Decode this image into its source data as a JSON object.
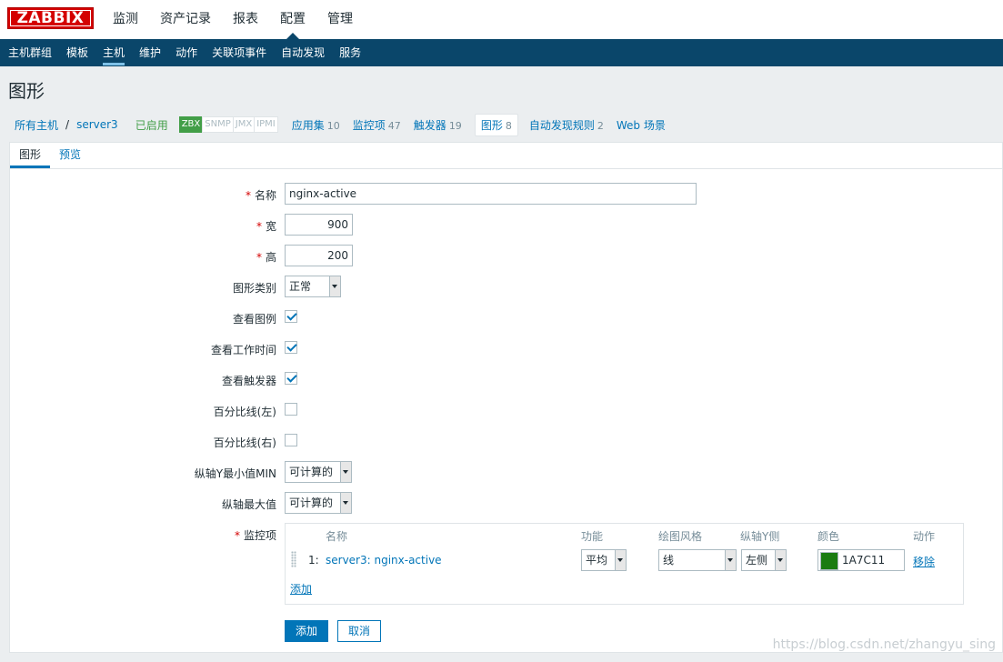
{
  "logo": "ZABBIX",
  "main_menu": [
    {
      "label": "监测"
    },
    {
      "label": "资产记录"
    },
    {
      "label": "报表"
    },
    {
      "label": "配置"
    },
    {
      "label": "管理"
    }
  ],
  "sub_menu": [
    {
      "label": "主机群组"
    },
    {
      "label": "模板"
    },
    {
      "label": "主机"
    },
    {
      "label": "维护"
    },
    {
      "label": "动作"
    },
    {
      "label": "关联项事件"
    },
    {
      "label": "自动发现"
    },
    {
      "label": "服务"
    }
  ],
  "page_title": "图形",
  "host_nav": {
    "all_hosts": "所有主机",
    "separator": "/",
    "host": "server3",
    "status": "已启用",
    "availability": [
      "ZBX",
      "SNMP",
      "JMX",
      "IPMI"
    ],
    "items": [
      {
        "label": "应用集",
        "count": "10"
      },
      {
        "label": "监控项",
        "count": "47"
      },
      {
        "label": "触发器",
        "count": "19"
      },
      {
        "label": "图形",
        "count": "8"
      },
      {
        "label": "自动发现规则",
        "count": "2"
      },
      {
        "label": "Web 场景",
        "count": ""
      }
    ]
  },
  "tabs": [
    {
      "label": "图形"
    },
    {
      "label": "预览"
    }
  ],
  "form": {
    "name_label": "名称",
    "name_value": "nginx-active",
    "width_label": "宽",
    "width_value": "900",
    "height_label": "高",
    "height_value": "200",
    "type_label": "图形类别",
    "type_value": "正常",
    "legend_label": "查看图例",
    "worktime_label": "查看工作时间",
    "triggers_label": "查看触发器",
    "pct_left_label": "百分比线(左)",
    "pct_right_label": "百分比线(右)",
    "ymin_label": "纵轴Y最小值MIN",
    "ymin_value": "可计算的",
    "ymax_label": "纵轴最大值",
    "ymax_value": "可计算的",
    "items_label": "监控项",
    "required_mark": "*"
  },
  "items_table": {
    "headers": {
      "name": "名称",
      "func": "功能",
      "style": "绘图风格",
      "yaxis": "纵轴Y侧",
      "color": "颜色",
      "action": "动作"
    },
    "rows": [
      {
        "index": "1:",
        "name": "server3: nginx-active",
        "func": "平均",
        "style": "线",
        "yaxis": "左侧",
        "color": "1A7C11",
        "action": "移除"
      }
    ],
    "add_link": "添加"
  },
  "buttons": {
    "add": "添加",
    "cancel": "取消"
  },
  "watermark": "https://blog.csdn.net/zhangyu_sing",
  "colors": {
    "accent": "#0275b8",
    "header": "#0a466a",
    "logo": "#d40000",
    "enabled": "#429e47",
    "item_color": "#1A7C11"
  }
}
